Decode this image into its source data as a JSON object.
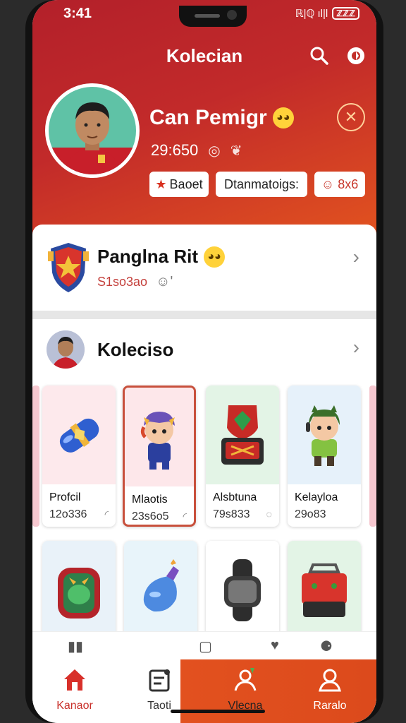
{
  "status_bar": {
    "time": "3:41",
    "icons": "ℝ|ℚ ıl|l",
    "battery": "ℤℤℤ"
  },
  "header": {
    "title": "Kolecian",
    "search_icon": "search-icon",
    "settings_icon": "gear-icon"
  },
  "profile": {
    "name": "Can Pemigr",
    "score": "29:650",
    "chips": {
      "badge": "Baoet",
      "status": "Dtanmatoigs:",
      "count": "8x6"
    },
    "colors": {
      "hero_start": "#b3202a",
      "hero_end": "#e2531f"
    }
  },
  "ranking_card": {
    "title": "Panglna Rit",
    "value": "S1so3ao"
  },
  "collection": {
    "title": "Koleciso",
    "items": [
      {
        "name": "Profcil",
        "value": "12o336",
        "selected": false,
        "bg": "#fde9ec"
      },
      {
        "name": "Mlaotis",
        "value": "23s6o5",
        "selected": true,
        "bg": "#fde7ea"
      },
      {
        "name": "Alsbtuna",
        "value": "79s833",
        "selected": false,
        "bg": "#e3f4e6"
      },
      {
        "name": "Kelayloa",
        "value": "29o83",
        "selected": false,
        "bg": "#e6f1fa"
      }
    ],
    "items_row2": [
      {
        "bg": "#e9f2f9"
      },
      {
        "bg": "#e8f4fa"
      },
      {
        "bg": "#fff"
      },
      {
        "bg": "#e3f4e6"
      }
    ]
  },
  "bottom_nav": {
    "tabs": [
      {
        "label": "Kanaor",
        "icon": "home-icon"
      },
      {
        "label": "Taoti",
        "icon": "clipboard-icon"
      },
      {
        "label": "Vlecna",
        "icon": "person-badge-icon"
      },
      {
        "label": "Raralo",
        "icon": "profile-icon"
      }
    ],
    "active_color": "#c8302a",
    "accent": "#e2511f"
  }
}
